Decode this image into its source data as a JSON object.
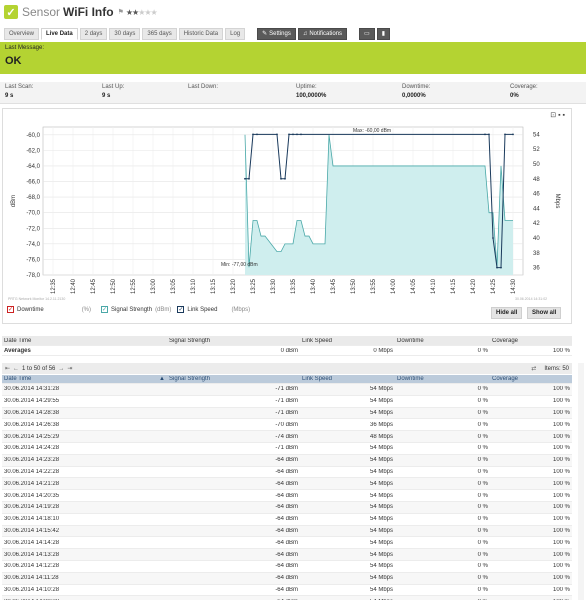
{
  "header": {
    "title_light": "Sensor",
    "title_bold": "WiFi Info",
    "pin_icon": "pin-icon",
    "rating": 2,
    "rating_max": 5
  },
  "tabs": [
    {
      "label": "Overview"
    },
    {
      "label": "Live Data"
    },
    {
      "label": "2 days"
    },
    {
      "label": "30 days"
    },
    {
      "label": "365 days"
    },
    {
      "label": "Historic Data"
    },
    {
      "label": "Log"
    }
  ],
  "toolbar": {
    "settings": "Settings",
    "notifications": "Notifications"
  },
  "status": {
    "label": "Last Message:",
    "value": "OK",
    "color": "#b4d332"
  },
  "stats": [
    {
      "key": "Last Scan:",
      "value": "9 s"
    },
    {
      "key": "Last Up:",
      "value": "9 s"
    },
    {
      "key": "Last Down:",
      "value": ""
    },
    {
      "key": "Uptime:",
      "value": "100,0000%"
    },
    {
      "key": "Downtime:",
      "value": "0,0000%"
    },
    {
      "key": "Coverage:",
      "value": "0%"
    }
  ],
  "chart": {
    "legend": [
      {
        "label": "Downtime",
        "unit": "(%)",
        "color": "#cc2222"
      },
      {
        "label": "Signal Strength",
        "unit": "(dBm)",
        "color": "#4aa8a8"
      },
      {
        "label": "Link Speed",
        "unit": "(Mbps)",
        "color": "#1a3a5c"
      }
    ],
    "hide_all": "Hide all",
    "show_all": "Show all",
    "footer_left": "PRTG Network Monitor 14.2.11.2130",
    "footer_right": "30.06.2014 14:31:02"
  },
  "chart_data": {
    "type": "line",
    "x": [
      "12:35",
      "12:40",
      "12:45",
      "12:50",
      "12:55",
      "13:00",
      "13:05",
      "13:10",
      "13:15",
      "13:20",
      "13:25",
      "13:30",
      "13:35",
      "13:40",
      "13:45",
      "13:50",
      "13:55",
      "14:00",
      "14:05",
      "14:10",
      "14:15",
      "14:20",
      "14:25",
      "14:30"
    ],
    "ylabel": "dBm",
    "y2label": "Mbps",
    "ylim": [
      -78,
      -59
    ],
    "y2lim": [
      35,
      55
    ],
    "yticks": [
      -60,
      -62,
      -64,
      -66,
      -68,
      -70,
      -72,
      -74,
      -76,
      -78
    ],
    "y2ticks": [
      54,
      52,
      50,
      48,
      46,
      44,
      42,
      40,
      38,
      36
    ],
    "max_label": "Max: -60,00 dBm",
    "min_label": "Min: -77,00 dBm",
    "series": [
      {
        "name": "Signal Strength",
        "x": [
          13.23,
          13.24,
          13.25,
          13.26,
          13.27,
          13.28,
          13.31,
          13.32,
          13.33,
          13.35,
          13.36,
          13.37,
          13.38,
          13.39,
          13.4,
          13.41,
          13.43,
          13.44,
          13.45,
          14.23,
          14.24,
          14.25,
          14.26,
          14.27,
          14.28,
          14.29,
          14.3
        ],
        "values": [
          -60,
          -77,
          -71,
          -71,
          -73,
          -73,
          -75,
          -75,
          -74,
          -74,
          -71,
          -71,
          -73,
          -73,
          -74,
          -74,
          -74,
          -60,
          -64,
          -64,
          -70,
          -70,
          -77,
          -64,
          -71,
          -71,
          -71
        ]
      },
      {
        "name": "Link Speed",
        "x": [
          13.23,
          13.24,
          13.25,
          13.26,
          13.31,
          13.32,
          13.33,
          13.34,
          13.35,
          13.36,
          13.37,
          14.23,
          14.24,
          14.25,
          14.26,
          14.27,
          14.28,
          14.3
        ],
        "values": [
          48,
          48,
          54,
          54,
          54,
          48,
          48,
          54,
          54,
          54,
          54,
          54,
          54,
          40,
          36,
          36,
          54,
          54
        ]
      }
    ]
  },
  "averages": {
    "headers": [
      "Date Time",
      "Signal Strength",
      "Link Speed",
      "Downtime",
      "Coverage"
    ],
    "row": [
      "Averages",
      "0 dBm",
      "0 Mbps",
      "0 %",
      "100 %"
    ]
  },
  "pager": {
    "text": "1 to 50 of 56",
    "items": "Items: 50"
  },
  "table": {
    "headers": [
      "Date Time",
      "Signal Strength",
      "Link Speed",
      "Downtime",
      "Coverage"
    ],
    "rows": [
      [
        "30.06.2014 14:31:28",
        "-71 dBm",
        "54 Mbps",
        "0 %",
        "100 %"
      ],
      [
        "30.06.2014 14:29:55",
        "-71 dBm",
        "54 Mbps",
        "0 %",
        "100 %"
      ],
      [
        "30.06.2014 14:28:38",
        "-71 dBm",
        "54 Mbps",
        "0 %",
        "100 %"
      ],
      [
        "30.06.2014 14:26:38",
        "-70 dBm",
        "36 Mbps",
        "0 %",
        "100 %"
      ],
      [
        "30.06.2014 14:25:29",
        "-74 dBm",
        "48 Mbps",
        "0 %",
        "100 %"
      ],
      [
        "30.06.2014 14:24:28",
        "-71 dBm",
        "54 Mbps",
        "0 %",
        "100 %"
      ],
      [
        "30.06.2014 14:23:28",
        "-64 dBm",
        "54 Mbps",
        "0 %",
        "100 %"
      ],
      [
        "30.06.2014 14:22:28",
        "-64 dBm",
        "54 Mbps",
        "0 %",
        "100 %"
      ],
      [
        "30.06.2014 14:21:28",
        "-64 dBm",
        "54 Mbps",
        "0 %",
        "100 %"
      ],
      [
        "30.06.2014 14:20:35",
        "-64 dBm",
        "54 Mbps",
        "0 %",
        "100 %"
      ],
      [
        "30.06.2014 14:19:28",
        "-64 dBm",
        "54 Mbps",
        "0 %",
        "100 %"
      ],
      [
        "30.06.2014 14:18:10",
        "-64 dBm",
        "54 Mbps",
        "0 %",
        "100 %"
      ],
      [
        "30.06.2014 14:15:42",
        "-64 dBm",
        "54 Mbps",
        "0 %",
        "100 %"
      ],
      [
        "30.06.2014 14:14:28",
        "-64 dBm",
        "54 Mbps",
        "0 %",
        "100 %"
      ],
      [
        "30.06.2014 14:13:28",
        "-64 dBm",
        "54 Mbps",
        "0 %",
        "100 %"
      ],
      [
        "30.06.2014 14:12:28",
        "-64 dBm",
        "54 Mbps",
        "0 %",
        "100 %"
      ],
      [
        "30.06.2014 14:11:28",
        "-64 dBm",
        "54 Mbps",
        "0 %",
        "100 %"
      ],
      [
        "30.06.2014 14:10:28",
        "-64 dBm",
        "54 Mbps",
        "0 %",
        "100 %"
      ],
      [
        "30.06.2014 14:09:28",
        "-64 dBm",
        "54 Mbps",
        "0 %",
        "100 %"
      ]
    ]
  }
}
